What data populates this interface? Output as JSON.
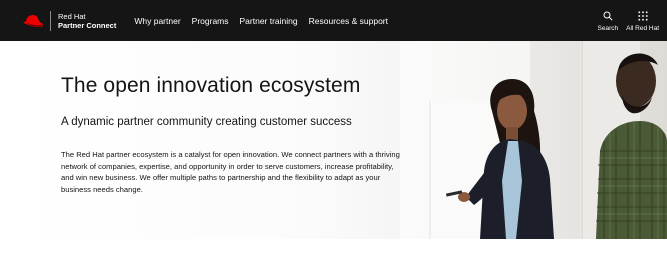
{
  "brand": {
    "line1": "Red Hat",
    "line2": "Partner Connect",
    "logo_icon": "red-hat-logo-icon"
  },
  "nav": {
    "links": [
      "Why partner",
      "Programs",
      "Partner training",
      "Resources & support"
    ]
  },
  "utility": {
    "search_label": "Search",
    "search_icon": "search-icon",
    "apps_label": "All Red Hat",
    "apps_icon": "grid-icon"
  },
  "hero": {
    "title": "The open innovation ecosystem",
    "subtitle": "A dynamic partner community creating customer success",
    "body": "The Red Hat partner ecosystem is a catalyst for open innovation. We connect partners with a thriving network of companies, expertise, and opportunity in order to serve customers, increase profitability, and win new business. We offer multiple paths to partnership and the flexibility to adapt as your business needs change."
  },
  "colors": {
    "nav_bg": "#151515",
    "brand_red": "#ee0000",
    "text": "#151515"
  }
}
